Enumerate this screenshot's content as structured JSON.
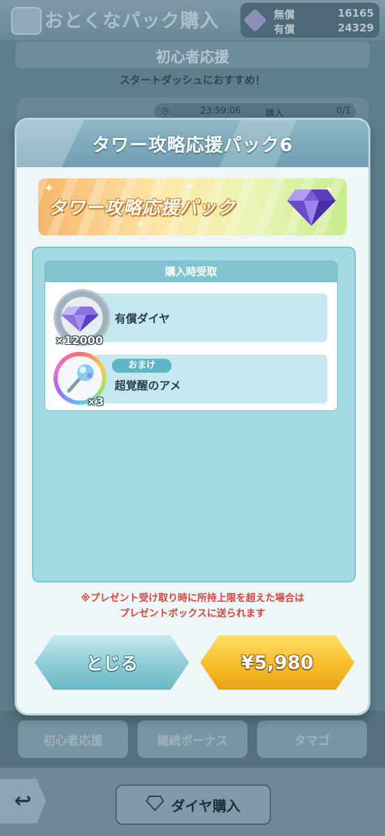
{
  "header": {
    "title": "おとくなパック購入",
    "currency": {
      "free_label": "無償",
      "free_value": "16165",
      "paid_label": "有償",
      "paid_value": "24329"
    }
  },
  "background": {
    "section_title": "初心者応援",
    "subtitle": "スタートダッシュにおすすめ！",
    "timer": "23:59:06",
    "purchase_label": "購入",
    "purchase_count": "0/1",
    "tabs": [
      "初心者応援",
      "継続ボーナス",
      "タマゴ"
    ],
    "back_icon": "↩",
    "buy_dia_label": "ダイヤ購入"
  },
  "modal": {
    "title": "タワー攻略応援パック6",
    "banner_text": "タワー攻略応援パック",
    "receive_header": "購入時受取",
    "items": [
      {
        "name": "有償ダイヤ",
        "quantity": "×12000",
        "icon": "gem-icon"
      },
      {
        "name": "超覚醒のアメ",
        "quantity": "×3",
        "badge": "おまけ",
        "icon": "candy-icon"
      }
    ],
    "notice_line1": "※プレゼント受け取り時に所持上限を超えた場合は",
    "notice_line2": "プレゼントボックスに送られます",
    "close_button": "とじる",
    "price_button": "¥5,980"
  },
  "colors": {
    "modal_bg": "#eef6f8",
    "panel_bg": "#a3dae3",
    "notice_red": "#d9453a",
    "buy_gold": "#f6bd2a",
    "close_teal": "#8ccbd6"
  }
}
